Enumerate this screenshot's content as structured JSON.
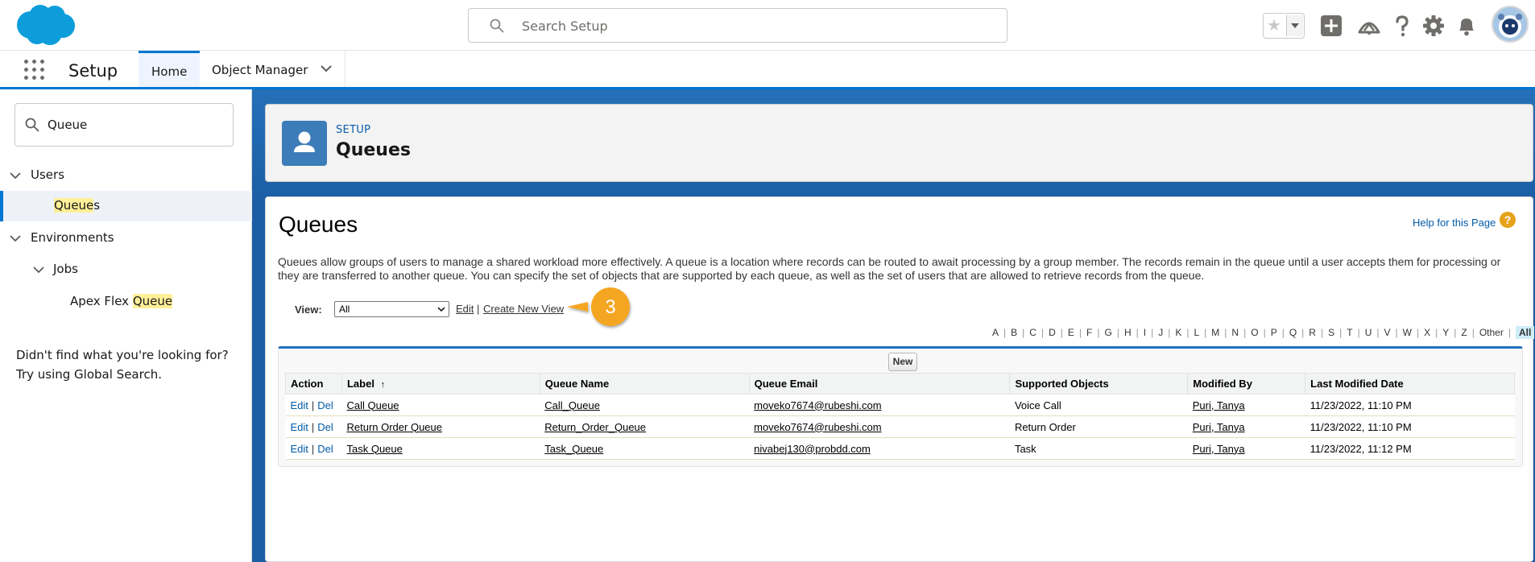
{
  "header": {
    "search_placeholder": "Search Setup"
  },
  "app_nav": {
    "app_name": "Setup",
    "tabs": [
      {
        "label": "Home",
        "active": true
      },
      {
        "label": "Object Manager",
        "active": false
      }
    ]
  },
  "sidebar": {
    "quick_find_value": "Queue",
    "tree": {
      "users": "Users",
      "queues_match": "Queue",
      "queues_rest": "s",
      "environments": "Environments",
      "jobs": "Jobs",
      "apex_prefix": "Apex Flex ",
      "apex_match": "Queue"
    },
    "not_found_line1": "Didn't find what you're looking for?",
    "not_found_line2": "Try using Global Search."
  },
  "page_header": {
    "breadcrumb": "SETUP",
    "title": "Queues"
  },
  "content": {
    "title": "Queues",
    "help_link": "Help for this Page",
    "help_icon": "?",
    "description": "Queues allow groups of users to manage a shared workload more effectively. A queue is a location where records can be routed to await processing by a group member. The records remain in the queue until a user accepts them for processing or they are transferred to another queue. You can specify the set of objects that are supported by each queue, as well as the set of users that are allowed to retrieve records from the queue.",
    "view_label": "View:",
    "view_selected": "All",
    "edit_link": "Edit",
    "view_separator": "|",
    "create_new_view": "Create New View",
    "callout_number": "3",
    "new_button": "New"
  },
  "alpha_filter": [
    "A",
    "B",
    "C",
    "D",
    "E",
    "F",
    "G",
    "H",
    "I",
    "J",
    "K",
    "L",
    "M",
    "N",
    "O",
    "P",
    "Q",
    "R",
    "S",
    "T",
    "U",
    "V",
    "W",
    "X",
    "Y",
    "Z",
    "Other",
    "All"
  ],
  "table": {
    "columns": [
      "Action",
      "Label",
      "Queue Name",
      "Queue Email",
      "Supported Objects",
      "Modified By",
      "Last Modified Date"
    ],
    "sort_indicator": "↑",
    "action_edit": "Edit",
    "action_del": "Del",
    "action_sep": "|",
    "rows": [
      {
        "label": "Call Queue",
        "queue_name": "Call_Queue",
        "email": "moveko7674@rubeshi.com",
        "objects": "Voice Call",
        "modified_by": "Puri, Tanya",
        "modified_date": "11/23/2022, 11:10 PM"
      },
      {
        "label": "Return Order Queue",
        "queue_name": "Return_Order_Queue",
        "email": "moveko7674@rubeshi.com",
        "objects": "Return Order",
        "modified_by": "Puri, Tanya",
        "modified_date": "11/23/2022, 11:10 PM"
      },
      {
        "label": "Task Queue",
        "queue_name": "Task_Queue",
        "email": "nivabej130@probdd.com",
        "objects": "Task",
        "modified_by": "Puri, Tanya",
        "modified_date": "11/23/2022, 11:12 PM"
      }
    ]
  },
  "colors": {
    "brand": "#0176d3",
    "header_band": "#1b5ea5",
    "callout": "#f4a620",
    "highlight": "#ffef99"
  },
  "icons": [
    "salesforce-cloud-logo",
    "search-icon",
    "favorite-star-icon",
    "favorites-dropdown-icon",
    "add-icon",
    "trailhead-icon",
    "help-icon",
    "gear-icon",
    "bell-icon",
    "user-avatar",
    "app-launcher-icon",
    "chevron-down-icon",
    "queue-user-icon"
  ]
}
